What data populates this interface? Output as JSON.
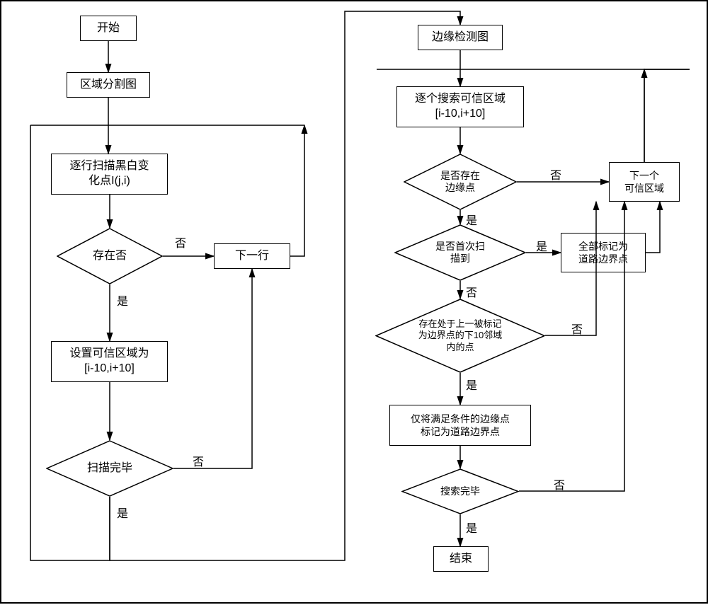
{
  "chart_data": {
    "type": "flowchart",
    "nodes": [
      {
        "id": "start",
        "shape": "rect",
        "label": "开始"
      },
      {
        "id": "regionSeg",
        "shape": "rect",
        "label": "区域分割图"
      },
      {
        "id": "scanRow",
        "shape": "rect",
        "label": "逐行扫描黑白变\n化点I(j,i)"
      },
      {
        "id": "existQ",
        "shape": "diamond",
        "label": "存在否"
      },
      {
        "id": "nextRow",
        "shape": "rect",
        "label": "下一行"
      },
      {
        "id": "setTrust",
        "shape": "rect",
        "label": "设置可信区域为\n[i-10,i+10]"
      },
      {
        "id": "scanDoneQ",
        "shape": "diamond",
        "label": "扫描完毕"
      },
      {
        "id": "edgeMap",
        "shape": "rect",
        "label": "边缘检测图"
      },
      {
        "id": "searchTrust",
        "shape": "rect",
        "label": "逐个搜索可信区域\n[i-10,i+10]"
      },
      {
        "id": "edgePointQ",
        "shape": "diamond",
        "label": "是否存在\n边缘点"
      },
      {
        "id": "firstScanQ",
        "shape": "diamond",
        "label": "是否首次扫\n描到"
      },
      {
        "id": "markAll",
        "shape": "rect",
        "label": "全部标记为\n道路边界点"
      },
      {
        "id": "neighborQ",
        "shape": "diamond",
        "label": "存在处于上一被标记\n为边界点的下10邻域\n内的点"
      },
      {
        "id": "markCond",
        "shape": "rect",
        "label": "仅将满足条件的边缘点\n标记为道路边界点"
      },
      {
        "id": "nextTrust",
        "shape": "rect",
        "label": "下一个\n可信区域"
      },
      {
        "id": "searchDoneQ",
        "shape": "diamond",
        "label": "搜索完毕"
      },
      {
        "id": "end",
        "shape": "rect",
        "label": "结束"
      }
    ],
    "edges": [
      {
        "from": "start",
        "to": "regionSeg"
      },
      {
        "from": "regionSeg",
        "to": "scanRow"
      },
      {
        "from": "scanRow",
        "to": "existQ"
      },
      {
        "from": "existQ",
        "to": "nextRow",
        "label": "否"
      },
      {
        "from": "existQ",
        "to": "setTrust",
        "label": "是"
      },
      {
        "from": "nextRow",
        "to": "scanRow"
      },
      {
        "from": "setTrust",
        "to": "scanDoneQ"
      },
      {
        "from": "scanDoneQ",
        "to": "nextRow",
        "label": "否"
      },
      {
        "from": "scanDoneQ",
        "to": "edgeMap",
        "label": "是"
      },
      {
        "from": "edgeMap",
        "to": "searchTrust"
      },
      {
        "from": "searchTrust",
        "to": "edgePointQ"
      },
      {
        "from": "edgePointQ",
        "to": "nextTrust",
        "label": "否"
      },
      {
        "from": "edgePointQ",
        "to": "firstScanQ",
        "label": "是"
      },
      {
        "from": "firstScanQ",
        "to": "markAll",
        "label": "是"
      },
      {
        "from": "firstScanQ",
        "to": "neighborQ",
        "label": "否"
      },
      {
        "from": "neighborQ",
        "to": "nextTrust",
        "label": "否"
      },
      {
        "from": "neighborQ",
        "to": "markCond",
        "label": "是"
      },
      {
        "from": "markAll",
        "to": "nextTrust"
      },
      {
        "from": "markCond",
        "to": "searchDoneQ"
      },
      {
        "from": "nextTrust",
        "to": "searchTrust"
      },
      {
        "from": "searchDoneQ",
        "to": "nextTrust",
        "label": "否"
      },
      {
        "from": "searchDoneQ",
        "to": "end",
        "label": "是"
      }
    ]
  },
  "labels": {
    "yes": "是",
    "no": "否"
  },
  "nodes": {
    "start": "开始",
    "regionSeg": "区域分割图",
    "scanRow_l1": "逐行扫描黑白变",
    "scanRow_l2": "化点I(j,i)",
    "existQ": "存在否",
    "nextRow": "下一行",
    "setTrust_l1": "设置可信区域为",
    "setTrust_l2": "[i-10,i+10]",
    "scanDoneQ": "扫描完毕",
    "edgeMap": "边缘检测图",
    "searchTrust_l1": "逐个搜索可信区域",
    "searchTrust_l2": "[i-10,i+10]",
    "edgePointQ_l1": "是否存在",
    "edgePointQ_l2": "边缘点",
    "firstScanQ_l1": "是否首次扫",
    "firstScanQ_l2": "描到",
    "markAll_l1": "全部标记为",
    "markAll_l2": "道路边界点",
    "neighborQ_l1": "存在处于上一被标记",
    "neighborQ_l2": "为边界点的下10邻域",
    "neighborQ_l3": "内的点",
    "markCond_l1": "仅将满足条件的边缘点",
    "markCond_l2": "标记为道路边界点",
    "nextTrust_l1": "下一个",
    "nextTrust_l2": "可信区域",
    "searchDoneQ": "搜索完毕",
    "end": "结束"
  }
}
